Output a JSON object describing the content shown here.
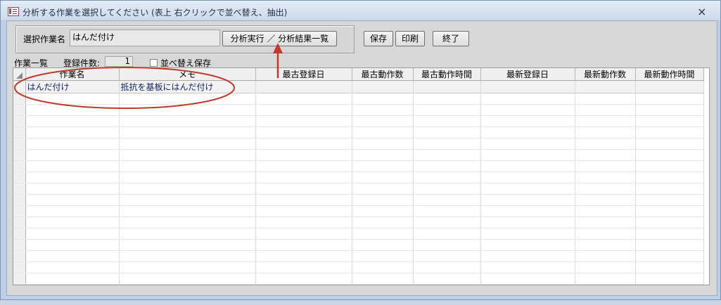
{
  "window": {
    "title": "分析する作業を選択してください (表上 右クリックで並べ替え、抽出)",
    "close_glyph": "×"
  },
  "top": {
    "selected_label": "選択作業名",
    "selected_value": "はんだ付け",
    "analyze_button": "分析実行 ／ 分析結果一覧",
    "save_button": "保存",
    "print_button": "印刷",
    "exit_button": "終了"
  },
  "list": {
    "title": "作業一覧",
    "count_label": "登録件数:",
    "count_value": "1",
    "sort_save_label": "並べ替え保存"
  },
  "grid": {
    "columns": [
      "作業名",
      "メモ",
      "最古登録日",
      "最古動作数",
      "最古動作時間",
      "最新登録日",
      "最新動作数",
      "最新動作時間"
    ],
    "rows": [
      [
        "はんだ付け",
        "抵抗を基板にはんだ付け",
        "",
        "",
        "",
        "",
        "",
        ""
      ]
    ]
  },
  "annotation_color": "#c0392b"
}
